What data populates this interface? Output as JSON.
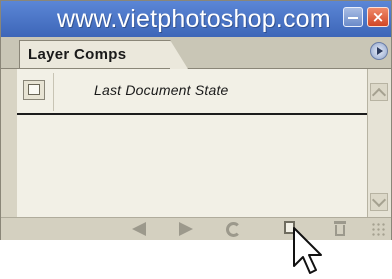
{
  "title_bar": {
    "watermark_text": "www.vietphotoshop.com",
    "minimize_icon": "minimize-icon",
    "close_icon": "close-icon",
    "close_glyph": "×"
  },
  "tabs": [
    {
      "label": "Layer Comps",
      "selected": true
    }
  ],
  "panel_menu_icon": "panel-menu-icon",
  "layer_comps": {
    "items": [
      {
        "label": "Last Document State",
        "icon": "document-state-icon"
      }
    ]
  },
  "bottom_toolbar": {
    "buttons": [
      {
        "icon": "previous-icon",
        "enabled": false
      },
      {
        "icon": "next-icon",
        "enabled": false
      },
      {
        "icon": "refresh-icon",
        "enabled": false
      },
      {
        "icon": "new-layer-comp-icon",
        "enabled": true
      },
      {
        "icon": "trash-icon",
        "enabled": false
      }
    ]
  },
  "colors": {
    "title_bar": "#4a74c8",
    "panel_bg": "#d8d4c4",
    "list_bg": "#f2f0e6"
  }
}
